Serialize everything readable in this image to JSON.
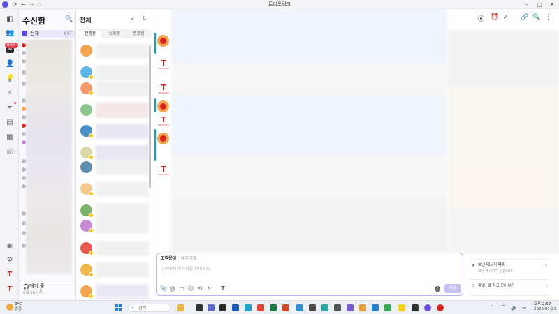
{
  "window": {
    "title": "트리오링크"
  },
  "rail": {
    "inbox_badge": "99+"
  },
  "inbox": {
    "title": "수신함",
    "all_label": "전체",
    "all_count": "697",
    "status_label": "대기 중",
    "status_duration": "6일 16시간"
  },
  "conversation_list": {
    "title": "전체",
    "tabs": [
      "진행중",
      "보류중",
      "종료됨"
    ]
  },
  "brand": {
    "name": "TRIOLINK"
  },
  "composer": {
    "tab_customer": "고객응대",
    "tab_internal": "내부대화",
    "placeholder": "고객에게 메시지를 보내세요.",
    "send_label": "전송"
  },
  "side_panel": {
    "sent_messages_title": "보낸 메시지 목록",
    "sent_messages_empty": "보낸 메시지가 없습니다.",
    "files_links_title": "파일, 웹 링크 모아보기"
  },
  "taskbar": {
    "temperature": "9°C",
    "weather": "맑음",
    "search_label": "검색",
    "time": "오후 2:57",
    "date": "2025-01-23"
  },
  "colors": {
    "accent": "#5b4ee0",
    "badge": "#e8394a",
    "brand_red": "#d8261f",
    "composer_border": "#b9b3f0",
    "send_button": "#c6c1f3",
    "active_thread_bar": "#0fa3b1"
  }
}
